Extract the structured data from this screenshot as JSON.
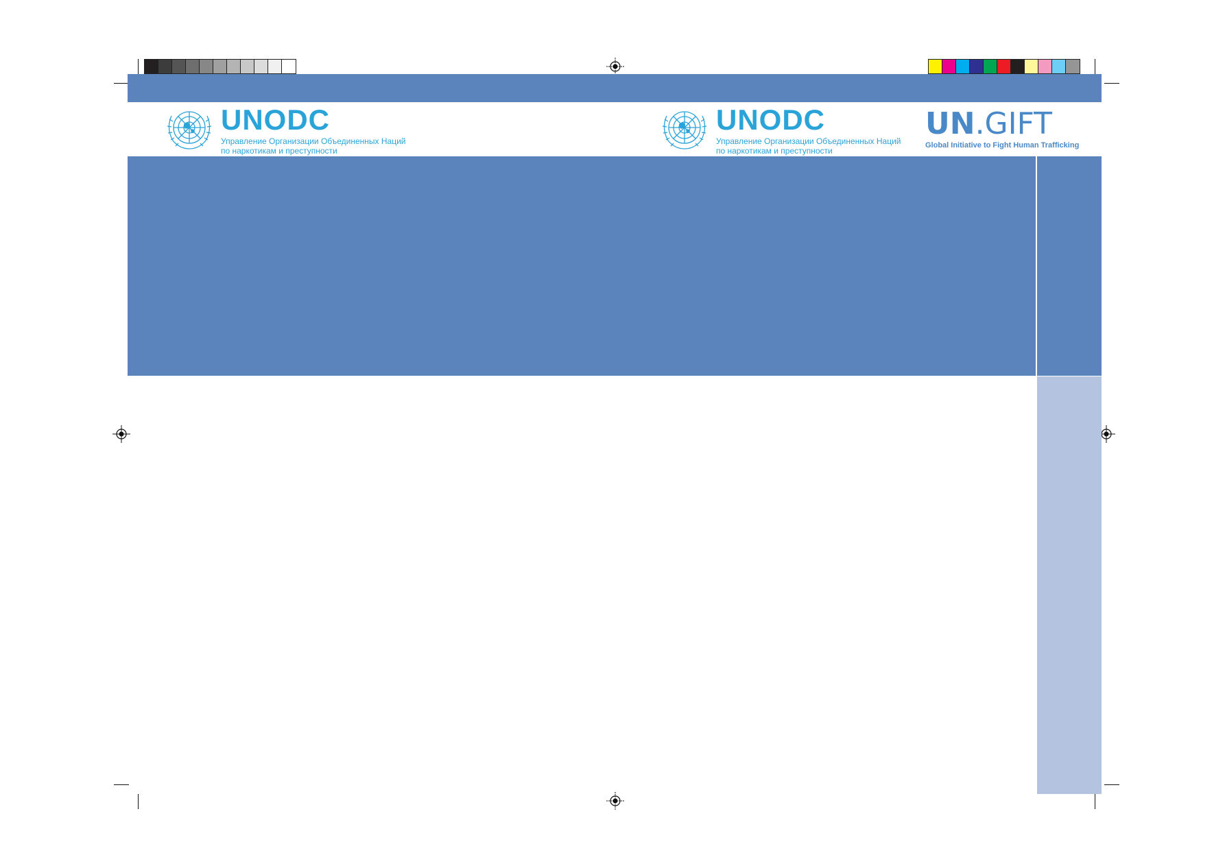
{
  "logos": {
    "unodc_left": {
      "name": "UNODC",
      "line1": "Управление Организации Объединенных Наций",
      "line2": "по наркотикам и преступности"
    },
    "unodc_right": {
      "name": "UNODC",
      "line1": "Управление Организации Объединенных Наций",
      "line2": "по наркотикам и преступности"
    },
    "ungift": {
      "name_bold": "UN",
      "name_rest": ".GIFT",
      "tagline": "Global Initiative to Fight Human Trafficking"
    }
  },
  "colors": {
    "band": "#5b84bc",
    "spine_lower": "#b4c3df",
    "logo_blue": "#2aa3d9",
    "ungift_blue": "#4a89c8"
  },
  "gray_strip": [
    "#231f20",
    "#3c3c3c",
    "#555555",
    "#6e6e6e",
    "#878787",
    "#a0a0a0",
    "#b4b4b4",
    "#c8c8c8",
    "#dcdcdc",
    "#f0f0f0",
    "#ffffff"
  ],
  "color_strip": [
    "#fff200",
    "#ec008c",
    "#00aeef",
    "#2e3192",
    "#00a651",
    "#ed1c24",
    "#231f20",
    "#fff799",
    "#f49ac1",
    "#6dcff6",
    "#959595"
  ]
}
